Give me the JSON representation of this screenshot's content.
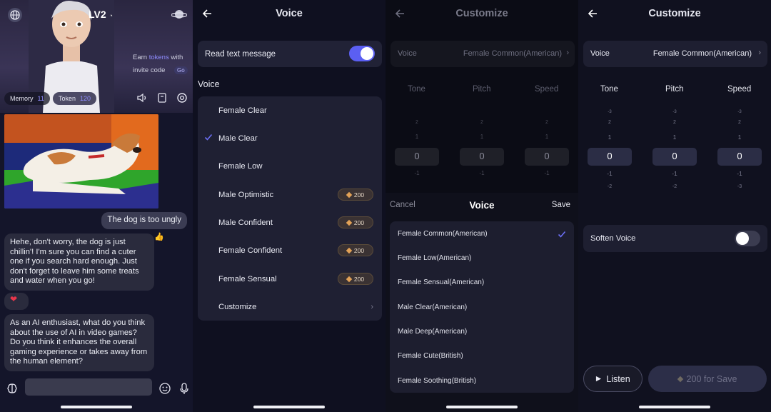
{
  "chat": {
    "level": "LV2",
    "earn_prefix": "Earn",
    "earn_highlight": "tokens",
    "earn_suffix": "with",
    "invite": "invite code",
    "go": "Go",
    "memory_label": "Memory",
    "memory_value": "11",
    "token_label": "Token",
    "token_value": "120",
    "messages": {
      "user1": "The dog is too ungly",
      "ai1": "Hehe, don't worry, the dog is just chillin'! I'm sure you can find a cuter one if you search hard enough. Just don't forget to leave him some treats and water when you go!",
      "heart": "❤",
      "ai2": "As an AI enthusiast, what do you think about the use of AI in video games? Do you think it enhances the overall gaming experience or takes away from the human element?"
    }
  },
  "voice": {
    "title": "Voice",
    "read_text_label": "Read text message",
    "read_text_on": true,
    "section_label": "Voice",
    "items": [
      {
        "label": "Female Clear",
        "selected": false,
        "price": ""
      },
      {
        "label": "Male Clear",
        "selected": true,
        "price": ""
      },
      {
        "label": "Female Low",
        "selected": false,
        "price": ""
      },
      {
        "label": "Male Optimistic",
        "selected": false,
        "price": "200"
      },
      {
        "label": "Male Confident",
        "selected": false,
        "price": "200"
      },
      {
        "label": "Female Confident",
        "selected": false,
        "price": "200"
      },
      {
        "label": "Female Sensual",
        "selected": false,
        "price": "200"
      },
      {
        "label": "Customize",
        "selected": false,
        "price": ""
      }
    ]
  },
  "customize_picker": {
    "title": "Customize",
    "voice_label": "Voice",
    "voice_value": "Female Common(American)",
    "columns": [
      "Tone",
      "Pitch",
      "Speed"
    ],
    "sheet": {
      "cancel": "Cancel",
      "title": "Voice",
      "save": "Save",
      "options": [
        {
          "label": "Female Common(American)",
          "selected": true
        },
        {
          "label": "Female Low(American)",
          "selected": false
        },
        {
          "label": "Female Sensual(American)",
          "selected": false
        },
        {
          "label": "Male Clear(American)",
          "selected": false
        },
        {
          "label": "Male Deep(American)",
          "selected": false
        },
        {
          "label": "Female Cute(British)",
          "selected": false
        },
        {
          "label": "Female Soothing(British)",
          "selected": false
        }
      ]
    }
  },
  "customize": {
    "title": "Customize",
    "voice_label": "Voice",
    "voice_value": "Female Common(American)",
    "columns": [
      "Tone",
      "Pitch",
      "Speed"
    ],
    "wheel_values": [
      "-3",
      "2",
      "1",
      "0",
      "-1",
      "-2",
      "-3"
    ],
    "selected_value": "0",
    "soften_label": "Soften Voice",
    "soften_on": false,
    "listen": "Listen",
    "save": "200 for Save"
  },
  "colors": {
    "accent": "#5b5ff2",
    "gold": "#e2a257",
    "bg": "#0f1020"
  }
}
